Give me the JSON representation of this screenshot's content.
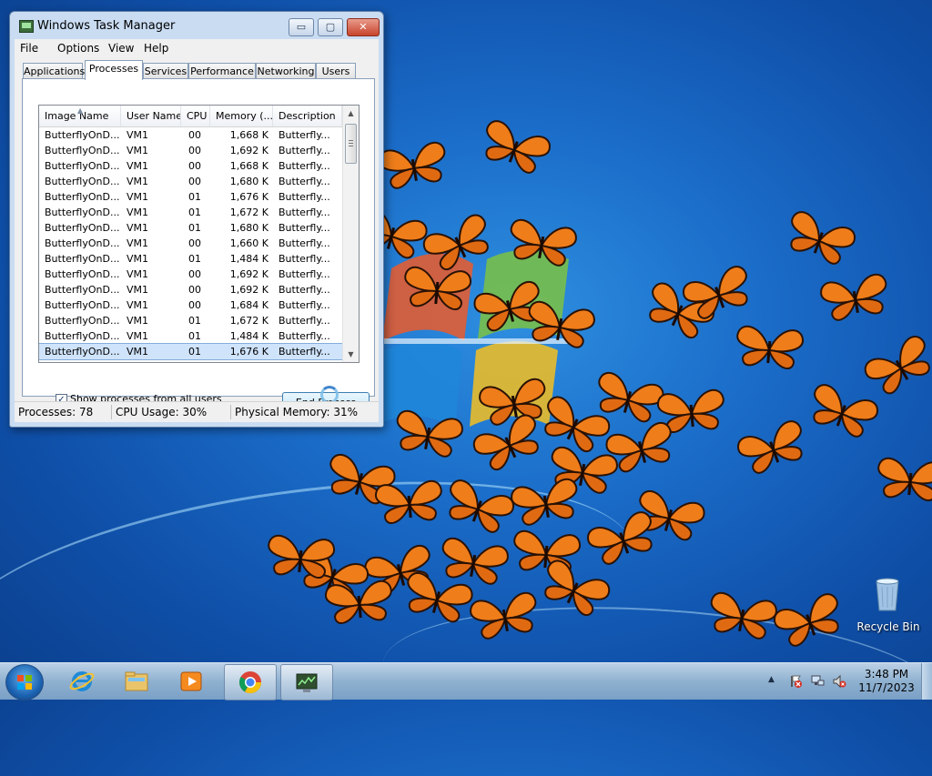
{
  "window": {
    "title": "Windows Task Manager",
    "controls": {
      "minimize": "▭",
      "maximize": "▢",
      "close": "✕"
    }
  },
  "menu": [
    "File",
    "Options",
    "View",
    "Help"
  ],
  "tabs": [
    "Applications",
    "Processes",
    "Services",
    "Performance",
    "Networking",
    "Users"
  ],
  "active_tab": "Processes",
  "columns": [
    "Image Name",
    "User Name",
    "CPU",
    "Memory (...",
    "Description"
  ],
  "processes": [
    {
      "name": "ButterflyOnD...",
      "user": "VM1",
      "cpu": "00",
      "mem": "1,668 K",
      "desc": "Butterfly..."
    },
    {
      "name": "ButterflyOnD...",
      "user": "VM1",
      "cpu": "00",
      "mem": "1,692 K",
      "desc": "Butterfly..."
    },
    {
      "name": "ButterflyOnD...",
      "user": "VM1",
      "cpu": "00",
      "mem": "1,668 K",
      "desc": "Butterfly..."
    },
    {
      "name": "ButterflyOnD...",
      "user": "VM1",
      "cpu": "00",
      "mem": "1,680 K",
      "desc": "Butterfly..."
    },
    {
      "name": "ButterflyOnD...",
      "user": "VM1",
      "cpu": "01",
      "mem": "1,676 K",
      "desc": "Butterfly..."
    },
    {
      "name": "ButterflyOnD...",
      "user": "VM1",
      "cpu": "01",
      "mem": "1,672 K",
      "desc": "Butterfly..."
    },
    {
      "name": "ButterflyOnD...",
      "user": "VM1",
      "cpu": "01",
      "mem": "1,680 K",
      "desc": "Butterfly..."
    },
    {
      "name": "ButterflyOnD...",
      "user": "VM1",
      "cpu": "00",
      "mem": "1,660 K",
      "desc": "Butterfly..."
    },
    {
      "name": "ButterflyOnD...",
      "user": "VM1",
      "cpu": "01",
      "mem": "1,484 K",
      "desc": "Butterfly..."
    },
    {
      "name": "ButterflyOnD...",
      "user": "VM1",
      "cpu": "00",
      "mem": "1,692 K",
      "desc": "Butterfly..."
    },
    {
      "name": "ButterflyOnD...",
      "user": "VM1",
      "cpu": "00",
      "mem": "1,692 K",
      "desc": "Butterfly..."
    },
    {
      "name": "ButterflyOnD...",
      "user": "VM1",
      "cpu": "00",
      "mem": "1,684 K",
      "desc": "Butterfly..."
    },
    {
      "name": "ButterflyOnD...",
      "user": "VM1",
      "cpu": "01",
      "mem": "1,672 K",
      "desc": "Butterfly..."
    },
    {
      "name": "ButterflyOnD...",
      "user": "VM1",
      "cpu": "01",
      "mem": "1,484 K",
      "desc": "Butterfly..."
    },
    {
      "name": "ButterflyOnD...",
      "user": "VM1",
      "cpu": "01",
      "mem": "1,676 K",
      "desc": "Butterfly..."
    }
  ],
  "selected_row": 14,
  "show_all_users": {
    "label": "Show processes from all users",
    "checked": true,
    "mark": "✓"
  },
  "end_process_label": "End Process",
  "status": {
    "processes": "Processes: 78",
    "cpu": "CPU Usage: 30%",
    "memory": "Physical Memory: 31%"
  },
  "desktop": {
    "recycle_bin_label": "Recycle Bin"
  },
  "taskbar": {
    "pinned": [
      "start-button",
      "internet-explorer-icon",
      "file-explorer-icon",
      "media-player-icon",
      "chrome-icon",
      "task-manager-icon"
    ],
    "active_app": "task-manager-icon"
  },
  "tray": {
    "arrow": "▲",
    "time": "3:48 PM",
    "date": "11/7/2023"
  },
  "colors": {
    "desktop_blue": "#1a6cc8",
    "butterfly_orange": "#ef7d1a",
    "selection": "#cfe3fb"
  }
}
